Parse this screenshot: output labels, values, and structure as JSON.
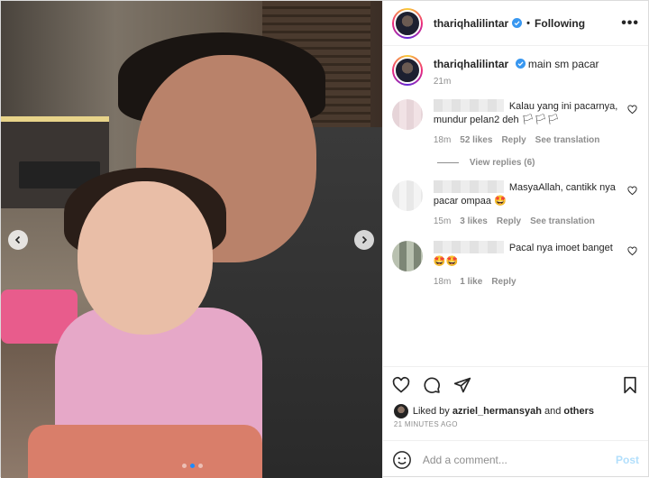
{
  "post": {
    "username": "thariqhalilintar",
    "following_label": "Following",
    "separator": "•",
    "more_label": "•••",
    "caption": "main sm pacar",
    "caption_time": "21m"
  },
  "comments": [
    {
      "text": "Kalau yang ini pacarnya, mundur pelan2 deh 🏳🏳🏳",
      "time": "18m",
      "likes": "52 likes",
      "reply": "Reply",
      "translate": "See translation"
    },
    {
      "text": "MasyaAllah, cantikk nya pacar ompaa 🤩",
      "time": "15m",
      "likes": "3 likes",
      "reply": "Reply",
      "translate": "See translation"
    },
    {
      "text": "Pacal nya imoet banget 🤩🤩",
      "time": "18m",
      "likes": "1 like",
      "reply": "Reply"
    }
  ],
  "view_replies": "View replies (6)",
  "liked_by": {
    "prefix": "Liked by",
    "user": "azriel_hermansyah",
    "middle": "and",
    "others": "others"
  },
  "time_ago": "21 MINUTES AGO",
  "add_comment": {
    "placeholder": "Add a comment...",
    "post_label": "Post"
  },
  "colors": {
    "verified": "#3897f0",
    "post_disabled": "#b2dffc",
    "muted": "#8e8e8e"
  }
}
